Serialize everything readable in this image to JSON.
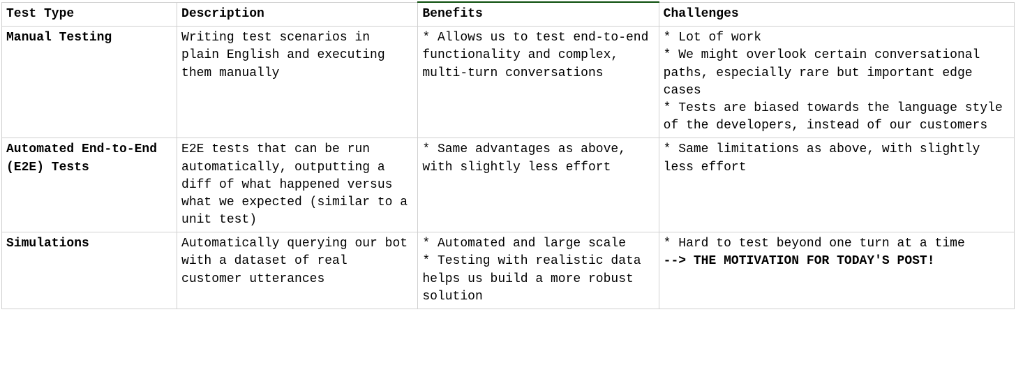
{
  "table": {
    "headers": [
      "Test Type",
      "Description",
      "Benefits",
      "Challenges"
    ],
    "rows": [
      {
        "type": "Manual Testing",
        "description": "Writing test scenarios in plain English and executing them manually",
        "benefits": [
          "* Allows us to test end-to-end functionality and complex, multi-turn conversations"
        ],
        "challenges": [
          "* Lot of work",
          "* We might overlook certain conversational paths, especially rare but important edge cases",
          "* Tests are biased towards the language style of the developers, instead of our customers"
        ],
        "challenges_bold": ""
      },
      {
        "type": "Automated End-to-End (E2E) Tests",
        "description": "E2E tests that can be run automatically, outputting a diff of what happened versus what we expected (similar to a unit test)",
        "benefits": [
          "* Same advantages as above, with slightly less effort"
        ],
        "challenges": [
          "* Same limitations as above, with slightly less effort"
        ],
        "challenges_bold": ""
      },
      {
        "type": "Simulations",
        "description": "Automatically querying our bot with a dataset of real customer utterances",
        "benefits": [
          "* Automated and large scale",
          "* Testing with realistic data helps us build a more robust solution"
        ],
        "challenges": [
          "* Hard to test beyond one turn at a time"
        ],
        "challenges_bold": "--> THE MOTIVATION FOR TODAY'S POST!"
      }
    ]
  }
}
